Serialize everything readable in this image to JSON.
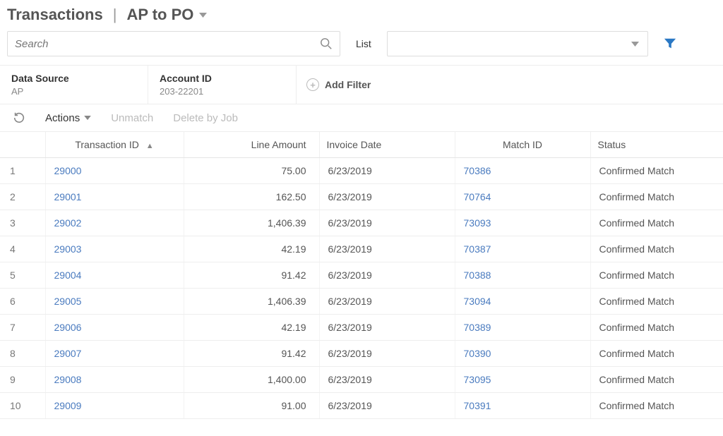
{
  "header": {
    "title": "Transactions",
    "subtitle": "AP to PO"
  },
  "search": {
    "placeholder": "Search",
    "list_label": "List"
  },
  "filters": {
    "data_source": {
      "label": "Data Source",
      "value": "AP"
    },
    "account_id": {
      "label": "Account ID",
      "value": "203-22201"
    },
    "add": "Add Filter"
  },
  "toolbar": {
    "actions": "Actions",
    "unmatch": "Unmatch",
    "delete_by_job": "Delete by Job"
  },
  "table": {
    "columns": {
      "transaction_id": "Transaction ID",
      "line_amount": "Line Amount",
      "invoice_date": "Invoice Date",
      "match_id": "Match ID",
      "status": "Status"
    },
    "rows": [
      {
        "n": "1",
        "tx": "29000",
        "amount": "75.00",
        "date": "6/23/2019",
        "match": "70386",
        "status": "Confirmed Match"
      },
      {
        "n": "2",
        "tx": "29001",
        "amount": "162.50",
        "date": "6/23/2019",
        "match": "70764",
        "status": "Confirmed Match"
      },
      {
        "n": "3",
        "tx": "29002",
        "amount": "1,406.39",
        "date": "6/23/2019",
        "match": "73093",
        "status": "Confirmed Match"
      },
      {
        "n": "4",
        "tx": "29003",
        "amount": "42.19",
        "date": "6/23/2019",
        "match": "70387",
        "status": "Confirmed Match"
      },
      {
        "n": "5",
        "tx": "29004",
        "amount": "91.42",
        "date": "6/23/2019",
        "match": "70388",
        "status": "Confirmed Match"
      },
      {
        "n": "6",
        "tx": "29005",
        "amount": "1,406.39",
        "date": "6/23/2019",
        "match": "73094",
        "status": "Confirmed Match"
      },
      {
        "n": "7",
        "tx": "29006",
        "amount": "42.19",
        "date": "6/23/2019",
        "match": "70389",
        "status": "Confirmed Match"
      },
      {
        "n": "8",
        "tx": "29007",
        "amount": "91.42",
        "date": "6/23/2019",
        "match": "70390",
        "status": "Confirmed Match"
      },
      {
        "n": "9",
        "tx": "29008",
        "amount": "1,400.00",
        "date": "6/23/2019",
        "match": "73095",
        "status": "Confirmed Match"
      },
      {
        "n": "10",
        "tx": "29009",
        "amount": "91.00",
        "date": "6/23/2019",
        "match": "70391",
        "status": "Confirmed Match"
      }
    ]
  }
}
